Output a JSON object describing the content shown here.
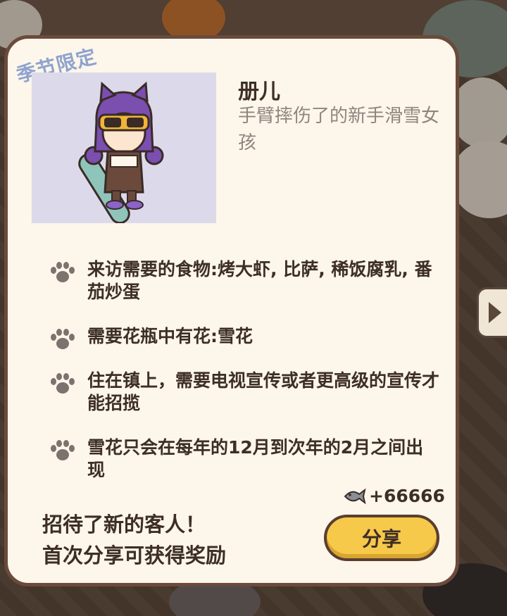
{
  "card": {
    "badge": "季节限定",
    "name": "册儿",
    "description": "手臂摔伤了的新手滑雪女孩"
  },
  "requirements": [
    {
      "icon": "paw-icon",
      "text": "来访需要的食物:烤大虾, 比萨, 稀饭腐乳, 番茄炒蛋"
    },
    {
      "icon": "paw-icon",
      "text": "需要花瓶中有花:雪花"
    },
    {
      "icon": "paw-icon",
      "text": "住在镇上，需要电视宣传或者更高级的宣传才能招揽"
    },
    {
      "icon": "paw-icon",
      "text": "雪花只会在每年的12月到次年的2月之间出现"
    }
  ],
  "reward": {
    "icon": "fish-icon",
    "amount": "+66666"
  },
  "message": {
    "line1": "招待了新的客人！",
    "line2": "首次分享可获得奖励"
  },
  "share_button": {
    "label": "分享"
  },
  "colors": {
    "card_bg": "#fdf6ea",
    "card_border": "#6b4a3c",
    "badge": "#8ea3cf",
    "button": "#f7c94a",
    "text": "#3d2e26",
    "subtext": "#8f8580"
  }
}
